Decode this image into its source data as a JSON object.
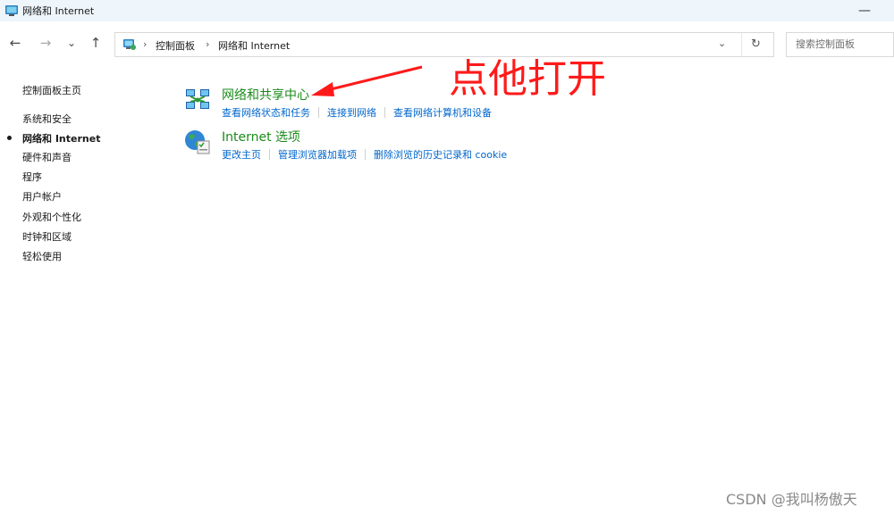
{
  "window": {
    "title": "网络和 Internet",
    "minimize_glyph": "—"
  },
  "nav": {
    "back_glyph": "←",
    "forward_glyph": "→",
    "recent_glyph": "⌄",
    "up_glyph": "↑"
  },
  "address": {
    "separator": "›",
    "crumbs": [
      "控制面板",
      "网络和 Internet"
    ],
    "dropdown_glyph": "⌄",
    "refresh_glyph": "↻"
  },
  "search": {
    "placeholder": "搜索控制面板"
  },
  "sidebar": {
    "items": [
      {
        "label": "控制面板主页",
        "current": false
      },
      {
        "label": "系统和安全",
        "current": false
      },
      {
        "label": "网络和 Internet",
        "current": true
      },
      {
        "label": "硬件和声音",
        "current": false
      },
      {
        "label": "程序",
        "current": false
      },
      {
        "label": "用户帐户",
        "current": false
      },
      {
        "label": "外观和个性化",
        "current": false
      },
      {
        "label": "时钟和区域",
        "current": false
      },
      {
        "label": "轻松使用",
        "current": false
      }
    ]
  },
  "categories": [
    {
      "title": "网络和共享中心",
      "icon": "network-sharing-icon",
      "links": [
        "查看网络状态和任务",
        "连接到网络",
        "查看网络计算机和设备"
      ]
    },
    {
      "title": "Internet 选项",
      "icon": "internet-options-icon",
      "links": [
        "更改主页",
        "管理浏览器加载项",
        "删除浏览的历史记录和 cookie"
      ]
    }
  ],
  "annotation": {
    "text": "点他打开",
    "color": "#ff1a1a"
  },
  "watermark": "CSDN @我叫杨傲天",
  "colors": {
    "category_title": "#1a8a1a",
    "link": "#0066cc",
    "titlebar_bg": "#eef5fb"
  }
}
